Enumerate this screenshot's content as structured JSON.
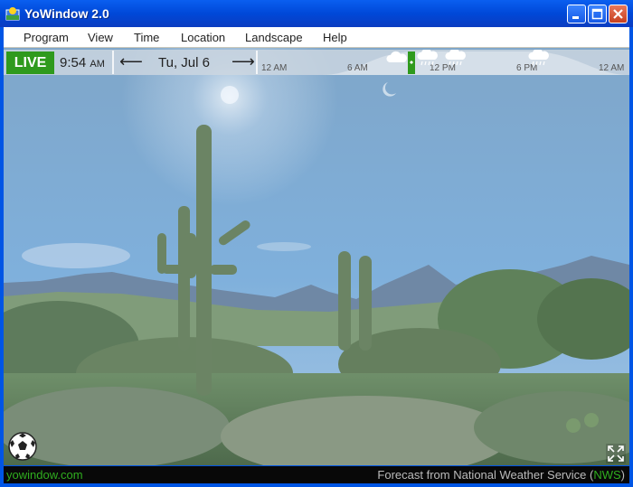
{
  "window": {
    "title": "YoWindow 2.0"
  },
  "menu": [
    "Program",
    "View",
    "Time",
    "Location",
    "Landscape",
    "Help"
  ],
  "timebar": {
    "live_label": "LIVE",
    "time": "9:54",
    "ampm": "AM",
    "date": "Tu, Jul 6",
    "prev_arrow": "⟵",
    "next_arrow": "⟶",
    "ticks": [
      "12 AM",
      "6 AM",
      "12 PM",
      "6 PM",
      "12 AM"
    ]
  },
  "status": {
    "brand": "yowindow.com",
    "credit_prefix": "Forecast from National Weather Service (",
    "credit_source": "NWS",
    "credit_suffix": ")"
  },
  "icons": {
    "app": "sun-window-icon",
    "minimize": "minimize-icon",
    "maximize": "maximize-icon",
    "close": "close-icon",
    "ball": "soccer-ball-icon",
    "fullscreen": "fullscreen-icon"
  },
  "colors": {
    "live": "#2f9a1d",
    "titlebar": "#0055e5",
    "brand": "#2fae1f"
  }
}
